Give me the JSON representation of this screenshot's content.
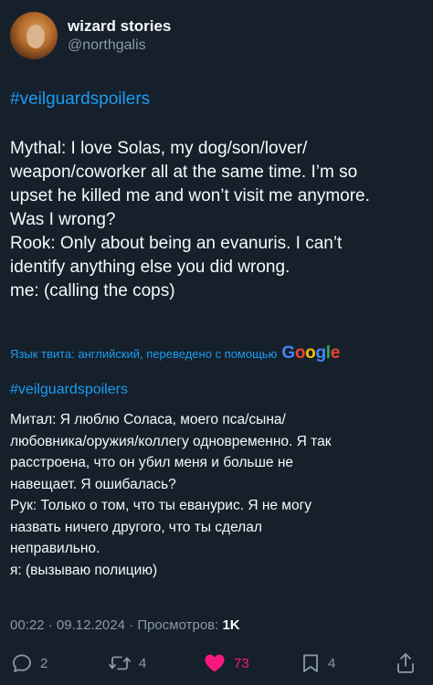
{
  "author": {
    "display_name": "wizard stories",
    "handle": "@northgalis"
  },
  "original": {
    "hashtag": "#veilguardspoilers",
    "lines": [
      "Mythal: I love Solas, my dog/son/lover/",
      "weapon/coworker all at the same time. I’m so",
      "upset he killed me and won’t visit me anymore.",
      "Was I wrong?",
      "Rook: Only about being an evanuris. I can’t",
      "identify anything else you did wrong.",
      "me: (calling the cops)"
    ]
  },
  "translation": {
    "note": "Язык твита: английский, переведено с помощью",
    "provider_logo": [
      "G",
      "o",
      "o",
      "g",
      "l",
      "e"
    ],
    "hashtag": "#veilguardspoilers",
    "lines": [
      "Митал: Я люблю Соласа, моего пса/сына/",
      "любовника/оружия/коллегу одновременно. Я так",
      "расстроена, что он убил меня и больше не",
      "навещает. Я ошибалась?",
      "Рук: Только о том, что ты еванурис. Я не могу",
      "назвать ничего другого, что ты сделал",
      "неправильно.",
      "я: (вызываю полицию)"
    ]
  },
  "meta": {
    "time": "00:22",
    "date": "09.12.2024",
    "separator": "·",
    "views_label": "Просмотров:",
    "views_count": "1K"
  },
  "actions": {
    "reply": {
      "icon": "reply-icon",
      "count": "2"
    },
    "repost": {
      "icon": "repost-icon",
      "count": "4"
    },
    "like": {
      "icon": "heart-icon",
      "count": "73",
      "active": true
    },
    "bookmark": {
      "icon": "bookmark-icon",
      "count": "4"
    },
    "share": {
      "icon": "share-icon"
    }
  },
  "colors": {
    "background": "#15202b",
    "text": "#f7f9f9",
    "secondary": "#8b98a5",
    "link": "#1d9bf0",
    "like": "#f91880"
  }
}
